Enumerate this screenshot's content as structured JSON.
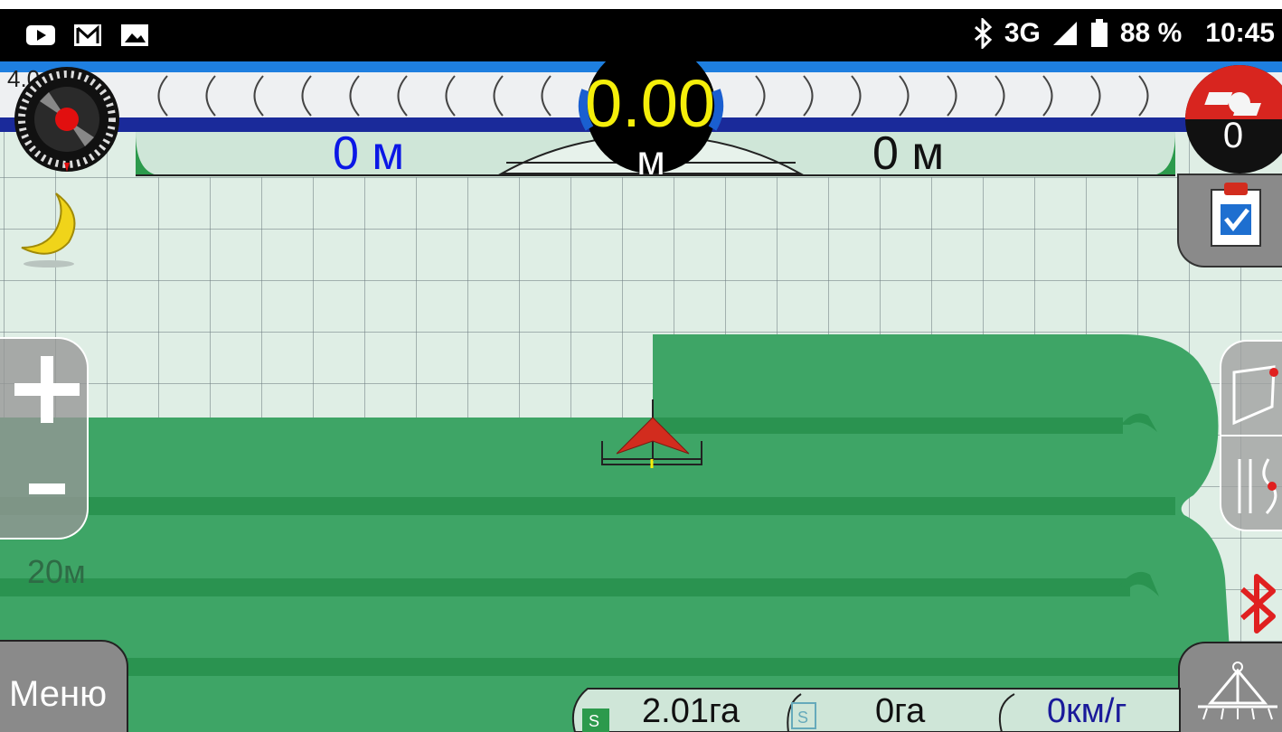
{
  "status_bar": {
    "left_icons": [
      "youtube-icon",
      "gmail-icon",
      "image-icon"
    ],
    "bluetooth_icon": "bluetooth-icon",
    "network": "3G",
    "signal_icon": "signal-icon",
    "battery_icon": "battery-icon",
    "battery": "88 %",
    "time": "10:45"
  },
  "guidance": {
    "lightbar_left_number": "4.0",
    "speed_value": "0.00",
    "speed_unit": "м",
    "offset_left": "0 м",
    "offset_right": "0 м",
    "section_counter": "0"
  },
  "map": {
    "scale_label": "20м"
  },
  "controls": {
    "zoom_in": "+",
    "zoom_out": "-",
    "menu_label": "Меню",
    "clipboard_icon": "clipboard-check-icon",
    "boundary_icon": "field-boundary-icon",
    "ab_line_icon": "ab-line-icon",
    "bluetooth_icon": "bluetooth-icon",
    "boom_icon": "boom-sprayer-icon",
    "night_icon": "moon-icon",
    "compass_icon": "compass-icon",
    "section_icon": "sections-icon"
  },
  "stats": {
    "area_value": "2.01га",
    "area_icon_letter": "S",
    "coverage_value": "0га",
    "coverage_icon_letter": "S",
    "speed_value": "0км/г"
  },
  "colors": {
    "coverage": "#3ea566",
    "swath_line": "#2a9350",
    "map_background": "#dfeee5",
    "speed_text": "#f5ef0a",
    "offset_left_text": "#0b17e6",
    "vehicle_red": "#d22c1e",
    "bluetooth_red": "#e02020"
  }
}
